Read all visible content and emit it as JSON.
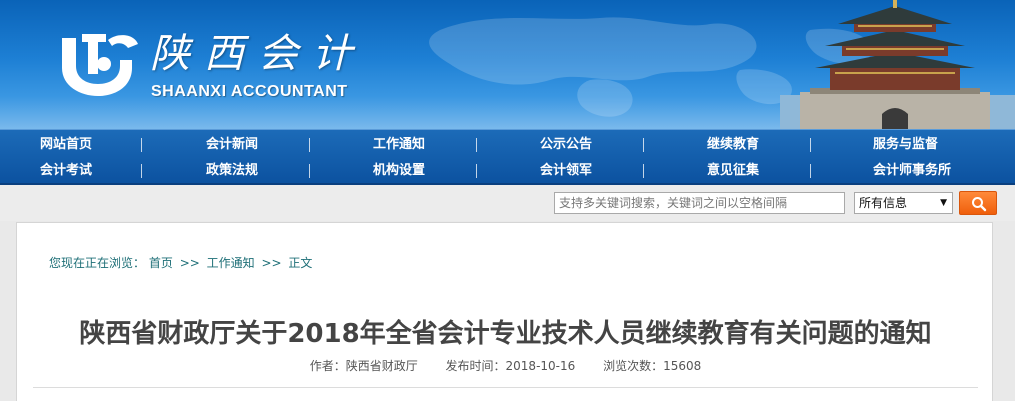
{
  "header": {
    "logo_cn": "陕西会计",
    "logo_en": "SHAANXI ACCOUNTANT"
  },
  "nav": {
    "row1": [
      "网站首页",
      "会计新闻",
      "工作通知",
      "公示公告",
      "继续教育",
      "服务与监督"
    ],
    "row2": [
      "会计考试",
      "政策法规",
      "机构设置",
      "会计领军",
      "意见征集",
      "会计师事务所"
    ]
  },
  "search": {
    "placeholder": "支持多关键词搜索，关键词之间以空格间隔",
    "select_value": "所有信息",
    "button_icon": "search-icon"
  },
  "breadcrumb": {
    "prefix": "您现在正在浏览：",
    "items": [
      "首页",
      "工作通知",
      "正文"
    ],
    "separator": ">>"
  },
  "article": {
    "title": "陕西省财政厅关于2018年全省会计专业技术人员继续教育有关问题的通知",
    "author": "作者：陕西省财政厅",
    "publish_time": "发布时间：2018-10-16",
    "views": "浏览次数：15608"
  },
  "colors": {
    "nav_bg": "#0c52a0",
    "accent_orange": "#ef5f0c",
    "breadcrumb_text": "#1e6f77"
  }
}
